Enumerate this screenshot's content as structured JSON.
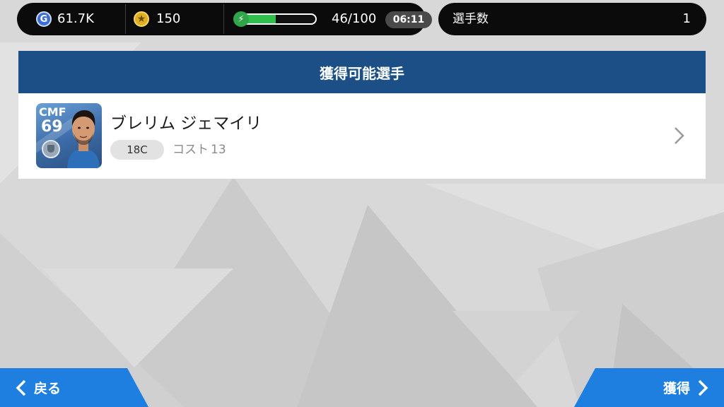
{
  "header": {
    "gp": {
      "icon": "gp-coin-icon",
      "value": "61.7K"
    },
    "coins": {
      "icon": "star-coin-icon",
      "value": "150"
    },
    "energy": {
      "icon": "lightning-icon",
      "value": "46/100",
      "fraction": 0.46,
      "timer": "06:11"
    },
    "players_count": {
      "label": "選手数",
      "value": "1"
    }
  },
  "panel": {
    "title": "獲得可能選手",
    "players": [
      {
        "position": "CMF",
        "rating": "69",
        "name": "ブレリム ジェマイリ",
        "class": "18C",
        "cost_label": "コスト",
        "cost_value": "13"
      }
    ]
  },
  "footer": {
    "back_label": "戻る",
    "get_label": "獲得"
  },
  "colors": {
    "header_bg": "#1b4f86",
    "button_bg": "#1e7fe0",
    "energy_fill": "#2fbf4a",
    "pill_bg": "#0b0b0b"
  }
}
